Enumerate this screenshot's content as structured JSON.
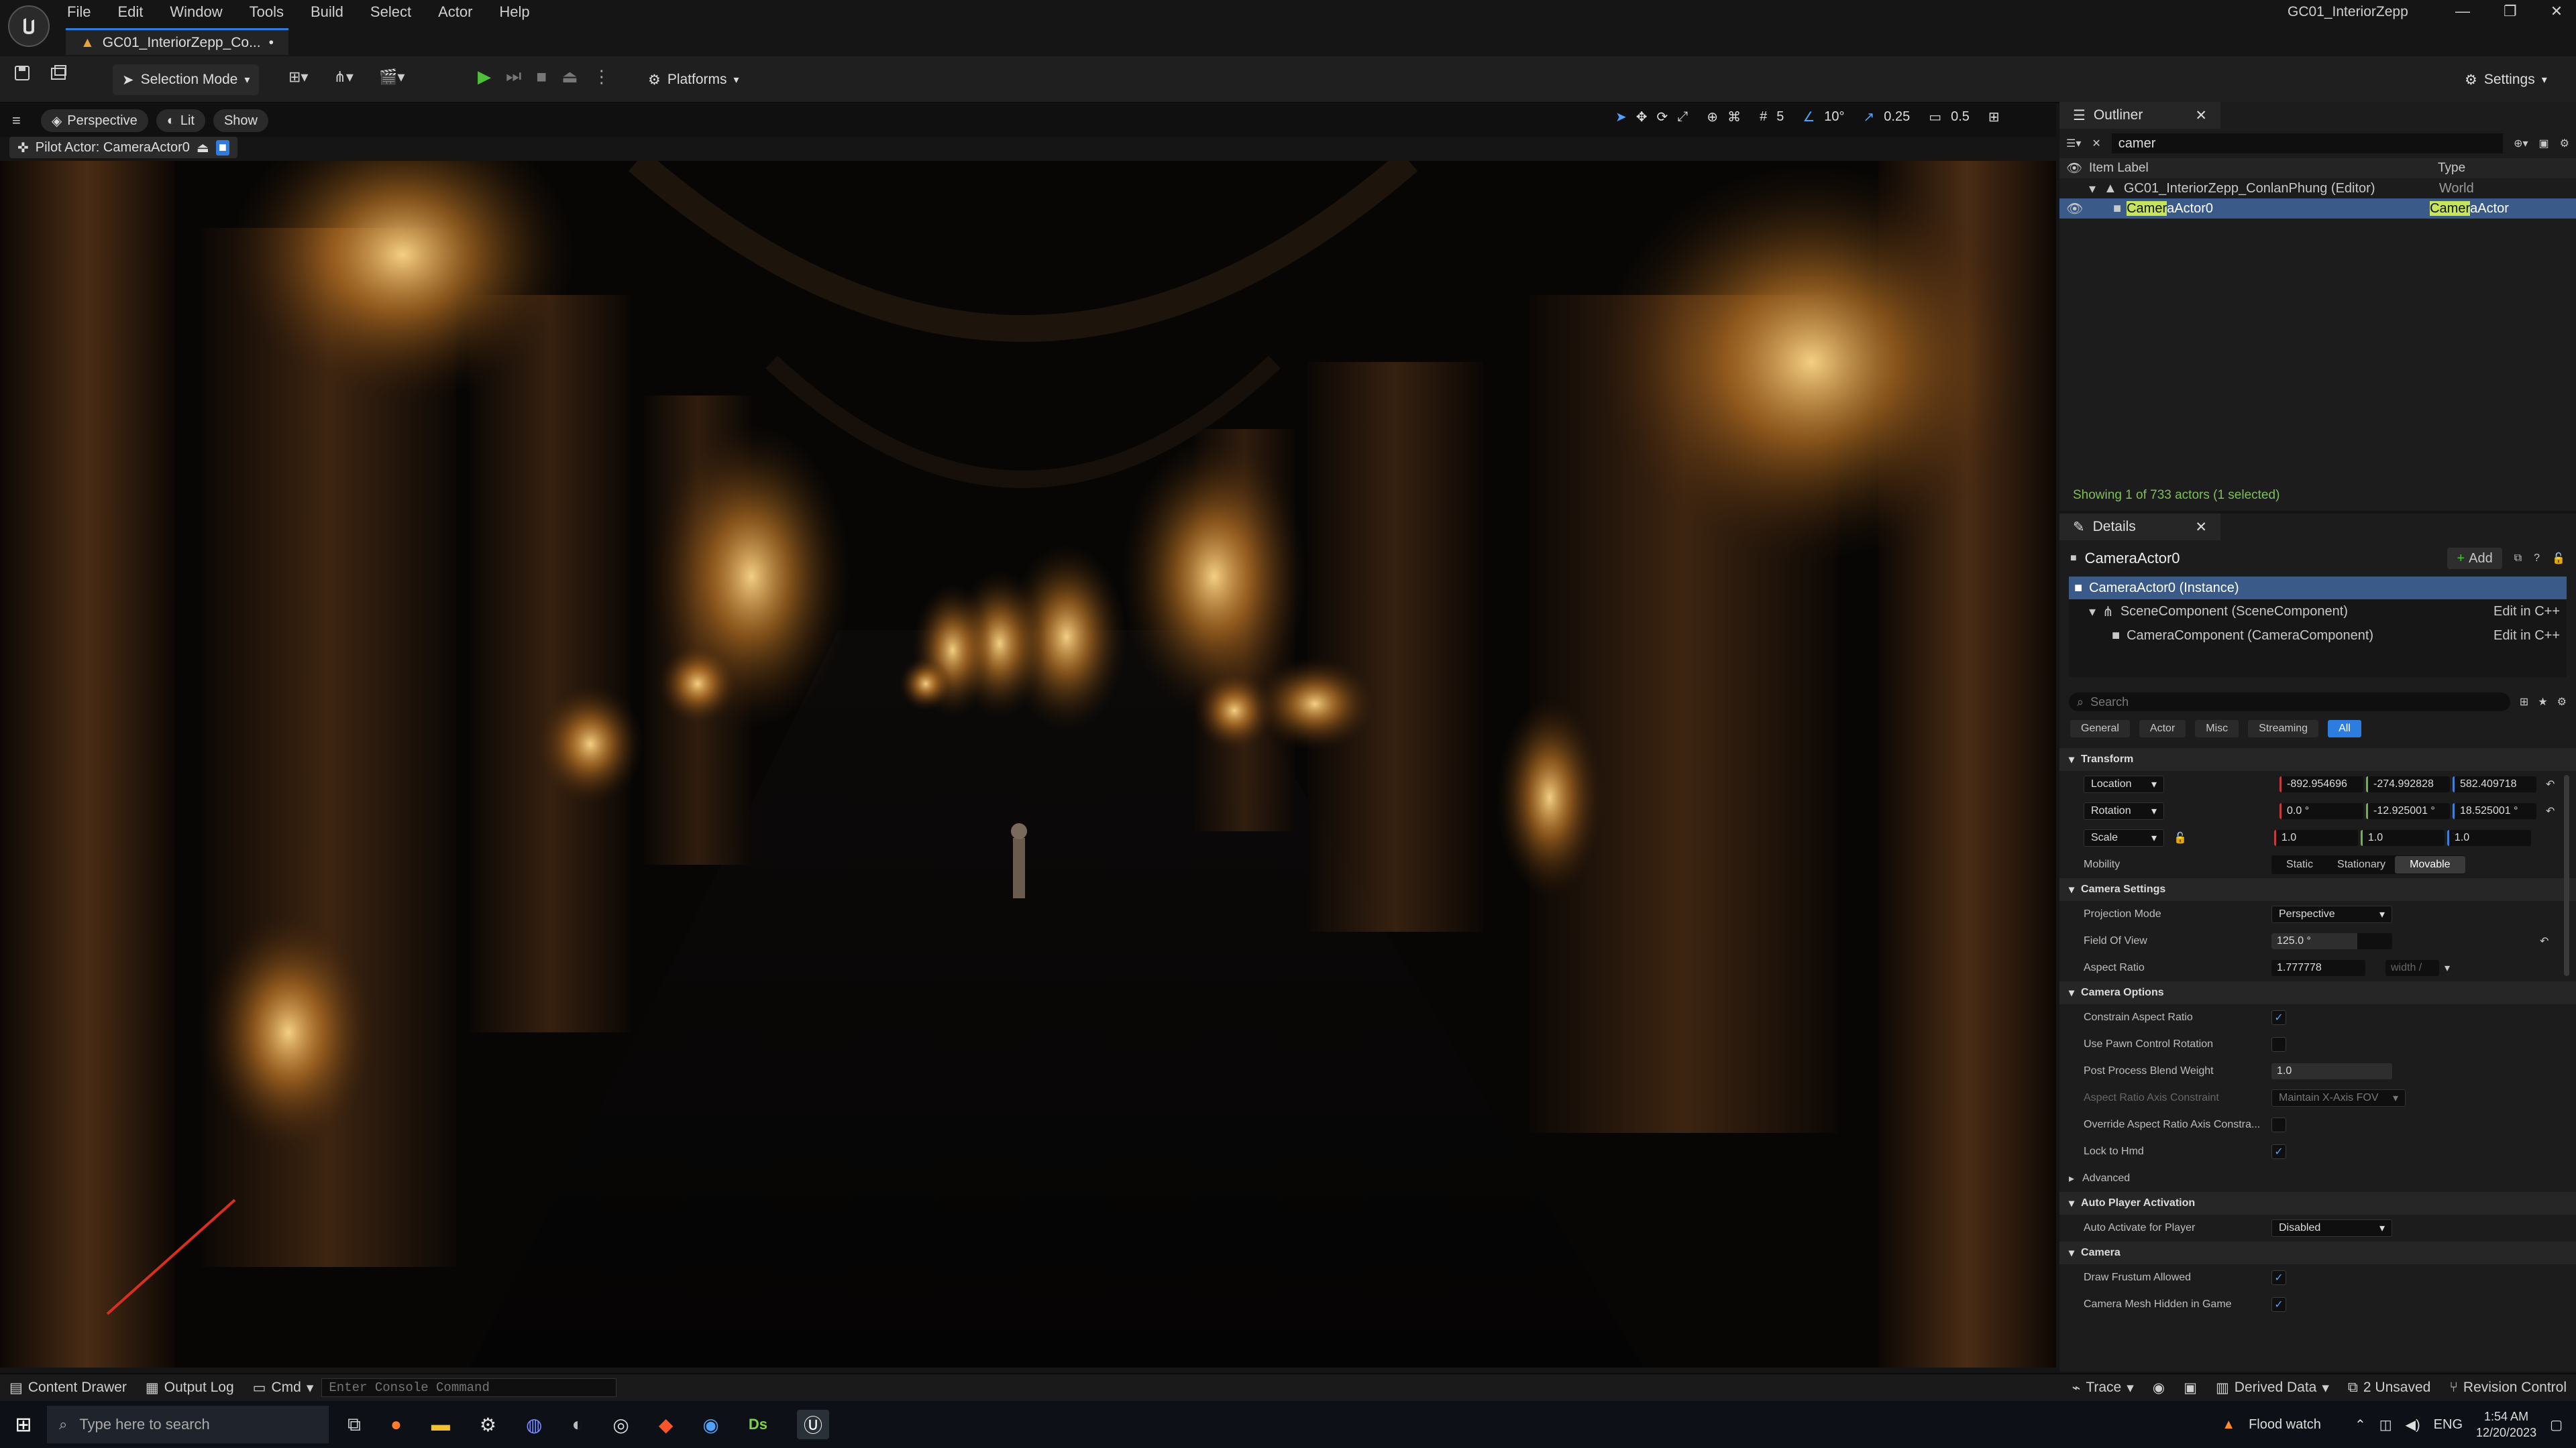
{
  "app": {
    "window_title": "GC01_InteriorZepp",
    "doc_tab": "GC01_InteriorZepp_Co...",
    "doc_tab_modified": "•"
  },
  "menu": [
    "File",
    "Edit",
    "Window",
    "Tools",
    "Build",
    "Select",
    "Actor",
    "Help"
  ],
  "toolbar": {
    "selection_mode": "Selection Mode",
    "platforms": "Platforms",
    "settings": "Settings"
  },
  "viewport": {
    "perspective": "Perspective",
    "lit": "Lit",
    "show": "Show",
    "pilot_actor": "Pilot Actor: CameraActor0",
    "grid_size": "5",
    "rotation_snap": "10°",
    "scale_snap": "0.25",
    "camera_speed": "0.5"
  },
  "outliner": {
    "title": "Outliner",
    "search_value": "camer",
    "col_label": "Item Label",
    "col_type": "Type",
    "rows": [
      {
        "label": "GC01_InteriorZepp_ConlanPhung (Editor)",
        "type": "World"
      },
      {
        "label_highlight": "Camer",
        "label_rest": "aActor0",
        "type_highlight": "Camer",
        "type_rest": "aActor"
      }
    ],
    "status": "Showing 1 of 733 actors (1 selected)"
  },
  "details": {
    "title": "Details",
    "actor_name": "CameraActor0",
    "add_label": "Add",
    "components": [
      {
        "label": "CameraActor0 (Instance)",
        "edit": ""
      },
      {
        "label": "SceneComponent (SceneComponent)",
        "edit": "Edit in C++"
      },
      {
        "label": "CameraComponent (CameraComponent)",
        "edit": "Edit in C++"
      }
    ],
    "search_placeholder": "Search",
    "filter_tabs": [
      "General",
      "Actor",
      "Misc",
      "Streaming",
      "All"
    ],
    "transform": {
      "header": "Transform",
      "location_label": "Location",
      "location": [
        "-892.954696",
        "-274.992828",
        "582.409718"
      ],
      "rotation_label": "Rotation",
      "rotation": [
        "0.0 °",
        "-12.925001 °",
        "18.525001 °"
      ],
      "scale_label": "Scale",
      "scale": [
        "1.0",
        "1.0",
        "1.0"
      ],
      "mobility_label": "Mobility",
      "mobility": [
        "Static",
        "Stationary",
        "Movable"
      ]
    },
    "camera_settings": {
      "header": "Camera Settings",
      "projection_label": "Projection Mode",
      "projection": "Perspective",
      "fov_label": "Field Of View",
      "fov": "125.0 °",
      "fov_fraction": 0.71,
      "aspect_label": "Aspect Ratio",
      "aspect": "1.777778",
      "aspect_secondary": "width /"
    },
    "camera_options": {
      "header": "Camera Options",
      "constrain": "Constrain Aspect Ratio",
      "pawn_rotation": "Use Pawn Control Rotation",
      "blend_weight_label": "Post Process Blend Weight",
      "blend_weight": "1.0",
      "axis_constraint_label": "Aspect Ratio Axis Constraint",
      "axis_constraint": "Maintain X-Axis FOV",
      "override_axis": "Override Aspect Ratio Axis Constra...",
      "lock_hmd": "Lock to Hmd",
      "advanced": "Advanced"
    },
    "auto_player": {
      "header": "Auto Player Activation",
      "label": "Auto Activate for Player",
      "value": "Disabled"
    },
    "camera": {
      "header": "Camera",
      "frustum": "Draw Frustum Allowed",
      "mesh_hidden": "Camera Mesh Hidden in Game"
    }
  },
  "statusbar": {
    "content_drawer": "Content Drawer",
    "output_log": "Output Log",
    "cmd": "Cmd",
    "console_placeholder": "Enter Console Command",
    "trace": "Trace",
    "derived_data": "Derived Data",
    "unsaved": "2 Unsaved",
    "revision_control": "Revision Control"
  },
  "taskbar": {
    "search_placeholder": "Type here to search",
    "weather": "Flood watch",
    "lang": "ENG",
    "time": "1:54 AM",
    "date": "12/20/2023"
  },
  "colors": {
    "accent": "#2d7de0",
    "selection": "#3a5a8a",
    "highlight": "#c6e55a",
    "x_axis": "#c43b3b",
    "y_axis": "#6bb34a",
    "z_axis": "#3f7fd6"
  }
}
